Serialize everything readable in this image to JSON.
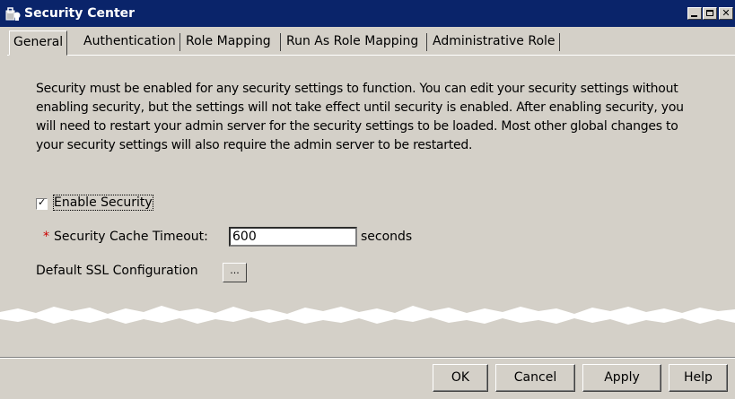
{
  "window": {
    "title": "Security Center"
  },
  "tabs": [
    {
      "label": "General",
      "active": true
    },
    {
      "label": "Authentication"
    },
    {
      "label": "Role Mapping"
    },
    {
      "label": "Run As Role Mapping"
    },
    {
      "label": "Administrative Role"
    }
  ],
  "general": {
    "description": "Security must be enabled for any security settings to function. You can edit your security settings without enabling security, but the settings will not take effect until security is enabled. After enabling security, you will need to restart your admin server for the security settings to be loaded. Most other global changes to your security settings will also require the admin server to be restarted.",
    "enable_security": {
      "label": "Enable Security",
      "checked": true
    },
    "cache_timeout": {
      "required_marker": "*",
      "label": "Security Cache Timeout:",
      "value": "600",
      "unit": "seconds"
    },
    "ssl": {
      "label": "Default SSL Configuration",
      "button_label": "..."
    }
  },
  "buttons": {
    "ok": "OK",
    "cancel": "Cancel",
    "apply": "Apply",
    "help": "Help"
  },
  "icons": {
    "window": "security-center-app-icon",
    "minimize": "minimize-icon",
    "maximize": "maximize-icon",
    "close": "close-icon",
    "checkbox": "check-icon"
  },
  "colors": {
    "titlebar": "#0a246a",
    "window_bg": "#d4d0c8",
    "required": "#cc0000"
  }
}
